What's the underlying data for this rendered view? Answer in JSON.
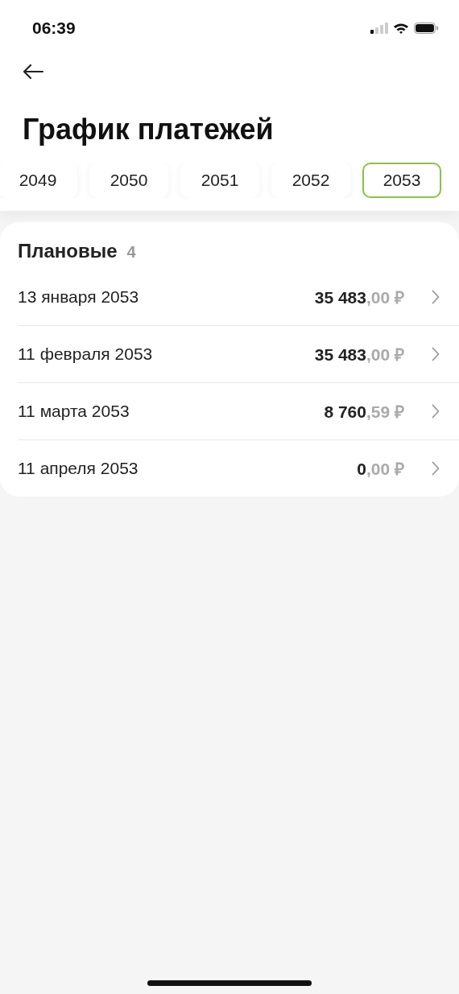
{
  "status_bar": {
    "time": "06:39"
  },
  "title": "График платежей",
  "years": [
    {
      "label": "2049",
      "selected": false
    },
    {
      "label": "2050",
      "selected": false
    },
    {
      "label": "2051",
      "selected": false
    },
    {
      "label": "2052",
      "selected": false
    },
    {
      "label": "2053",
      "selected": true
    }
  ],
  "section": {
    "title": "Плановые",
    "count": "4"
  },
  "payments": [
    {
      "date": "13 января 2053",
      "amount": "**35 483**,00 ₽"
    },
    {
      "date": "11 февраля 2053",
      "amount": "**35 483**,00 ₽"
    },
    {
      "date": "11 марта 2053",
      "amount": "**8 760**,59 ₽"
    },
    {
      "date": "11 апреля 2053",
      "amount": "**0**,00 ₽"
    }
  ]
}
